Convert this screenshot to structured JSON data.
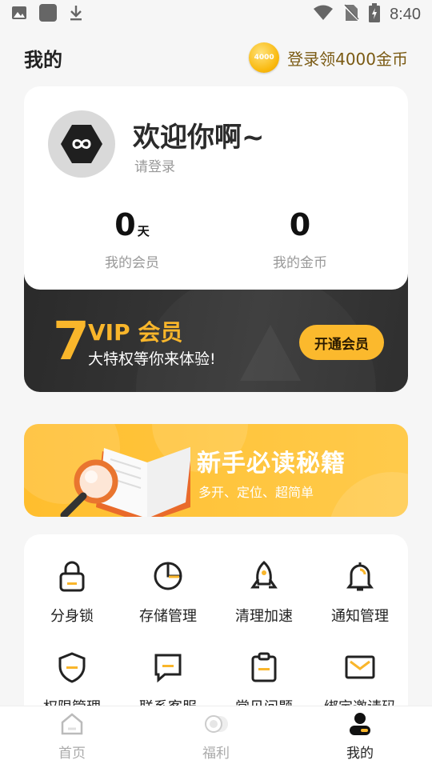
{
  "status_bar": {
    "time": "8:40",
    "icons": [
      "image-icon",
      "app-icon",
      "download-icon",
      "wifi-icon",
      "no-sim-icon",
      "battery-icon"
    ]
  },
  "header": {
    "title": "我的",
    "coin_badge": "4000",
    "coin_promo": "登录领4000金币"
  },
  "profile": {
    "welcome": "欢迎你啊~",
    "login_hint": "请登录",
    "member_days": "0",
    "member_unit": "天",
    "member_label": "我的会员",
    "coins": "0",
    "coins_label": "我的金币"
  },
  "vip": {
    "number": "7",
    "title": "VIP 会员",
    "subtitle": "大特权等你来体验!",
    "button": "开通会员",
    "accent": "#f9b62b"
  },
  "guide": {
    "title": "新手必读秘籍",
    "subtitle": "多开、定位、超简单"
  },
  "tools": [
    {
      "label": "分身锁",
      "icon": "lock-icon"
    },
    {
      "label": "存储管理",
      "icon": "pie-chart-icon"
    },
    {
      "label": "清理加速",
      "icon": "rocket-icon"
    },
    {
      "label": "通知管理",
      "icon": "bell-icon"
    },
    {
      "label": "权限管理",
      "icon": "shield-icon"
    },
    {
      "label": "联系客服",
      "icon": "chat-icon"
    },
    {
      "label": "常见问题",
      "icon": "clipboard-icon"
    },
    {
      "label": "绑定邀请码",
      "icon": "mail-icon"
    }
  ],
  "bottom_nav": [
    {
      "label": "首页",
      "icon": "home-icon"
    },
    {
      "label": "福利",
      "icon": "coin-toggle-icon"
    },
    {
      "label": "我的",
      "icon": "user-icon",
      "active": true
    }
  ]
}
